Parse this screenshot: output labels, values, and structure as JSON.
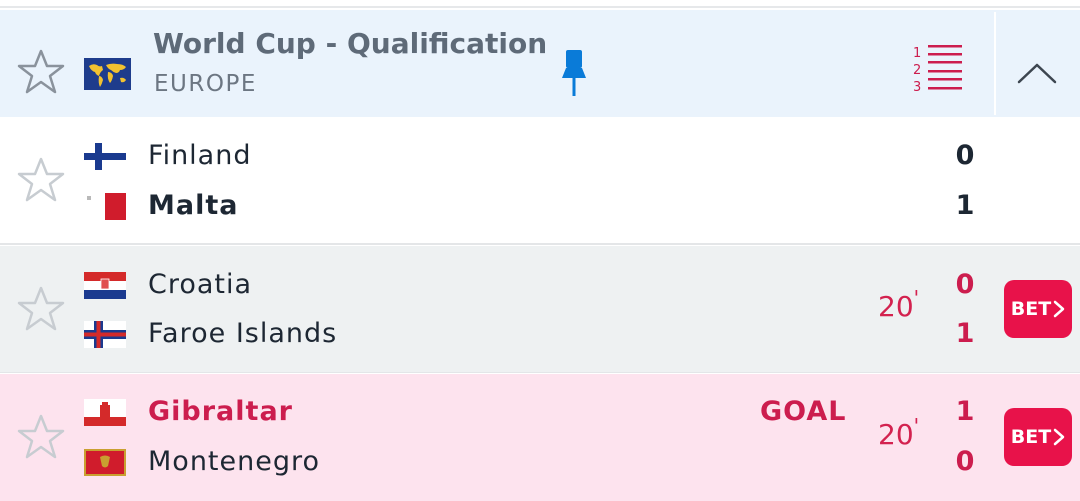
{
  "league": {
    "title": "World Cup - Qualification",
    "region": "EUROPE",
    "icons": [
      "star-outline-icon",
      "world-map-icon",
      "pin-icon",
      "standings-list-icon",
      "chevron-up-icon"
    ]
  },
  "matches": [
    {
      "home": {
        "name": "Finland",
        "score": "0",
        "flag": "finland-flag"
      },
      "away": {
        "name": "Malta",
        "score": "1",
        "flag": "malta-flag"
      },
      "minute": "",
      "status": ""
    },
    {
      "home": {
        "name": "Croatia",
        "score": "0",
        "flag": "croatia-flag"
      },
      "away": {
        "name": "Faroe Islands",
        "score": "1",
        "flag": "faroe-islands-flag"
      },
      "minute": "20",
      "status": "",
      "bet_label": "BET"
    },
    {
      "home": {
        "name": "Gibraltar",
        "score": "1",
        "flag": "gibraltar-flag"
      },
      "away": {
        "name": "Montenegro",
        "score": "0",
        "flag": "montenegro-flag"
      },
      "minute": "20",
      "status": "GOAL",
      "bet_label": "BET"
    }
  ],
  "colors": {
    "league_bg": "#eaf3fc",
    "accent_red": "#cc1d4e",
    "bet_button": "#e8124a",
    "goal_row_bg": "#fde3ee",
    "live_row_bg": "#eef1f2"
  }
}
